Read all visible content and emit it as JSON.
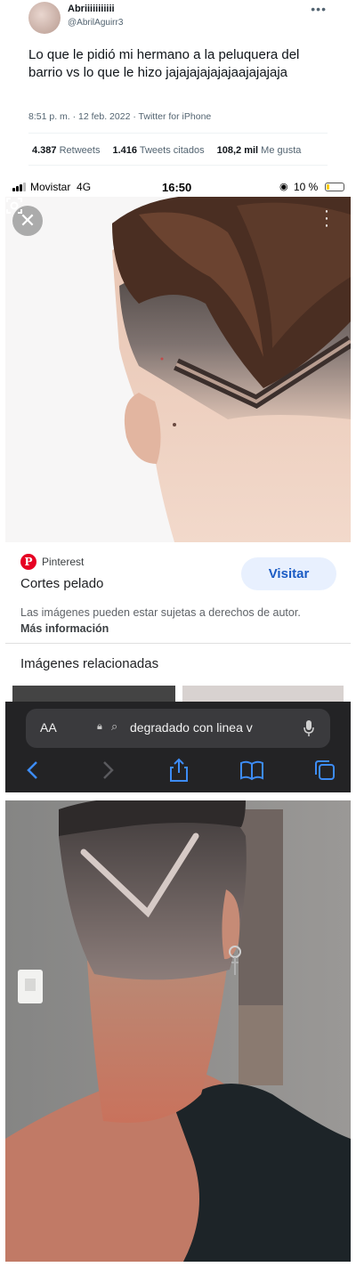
{
  "tweet": {
    "name": "Abriiiiiiiiiii",
    "handle": "@AbrilAguirr3",
    "text": "Lo que le pidió mi hermano a la peluquera del barrio vs lo que le hizo jajajajajajajaajajajaja",
    "meta": "8:51 p. m. · 12 feb. 2022 · Twitter for iPhone",
    "retweets_count": "4.387",
    "retweets_label": "Retweets",
    "quotes_count": "1.416",
    "quotes_label": "Tweets citados",
    "likes_count": "108,2 mil",
    "likes_label": "Me gusta",
    "more_icon": "more-horizontal-icon"
  },
  "phone": {
    "status": {
      "carrier": "Movistar",
      "network": "4G",
      "time": "16:50",
      "battery": "10 %",
      "battery_color": "#ffcc00"
    },
    "result": {
      "source": "Pinterest",
      "title": "Cortes pelado",
      "visit": "Visitar",
      "rights_text": "Las imágenes pueden estar sujetas a derechos de autor.",
      "rights_link": "Más información"
    },
    "related_title": "Imágenes relacionadas",
    "browser": {
      "aa": "AA",
      "url": "degradado con linea v"
    }
  },
  "colors": {
    "pinterest": "#e60023",
    "visit_bg": "#e8f0fe",
    "visit_text": "#1a5bc4",
    "safari_bg": "#232325",
    "safari_accent": "#3d8cf5"
  }
}
